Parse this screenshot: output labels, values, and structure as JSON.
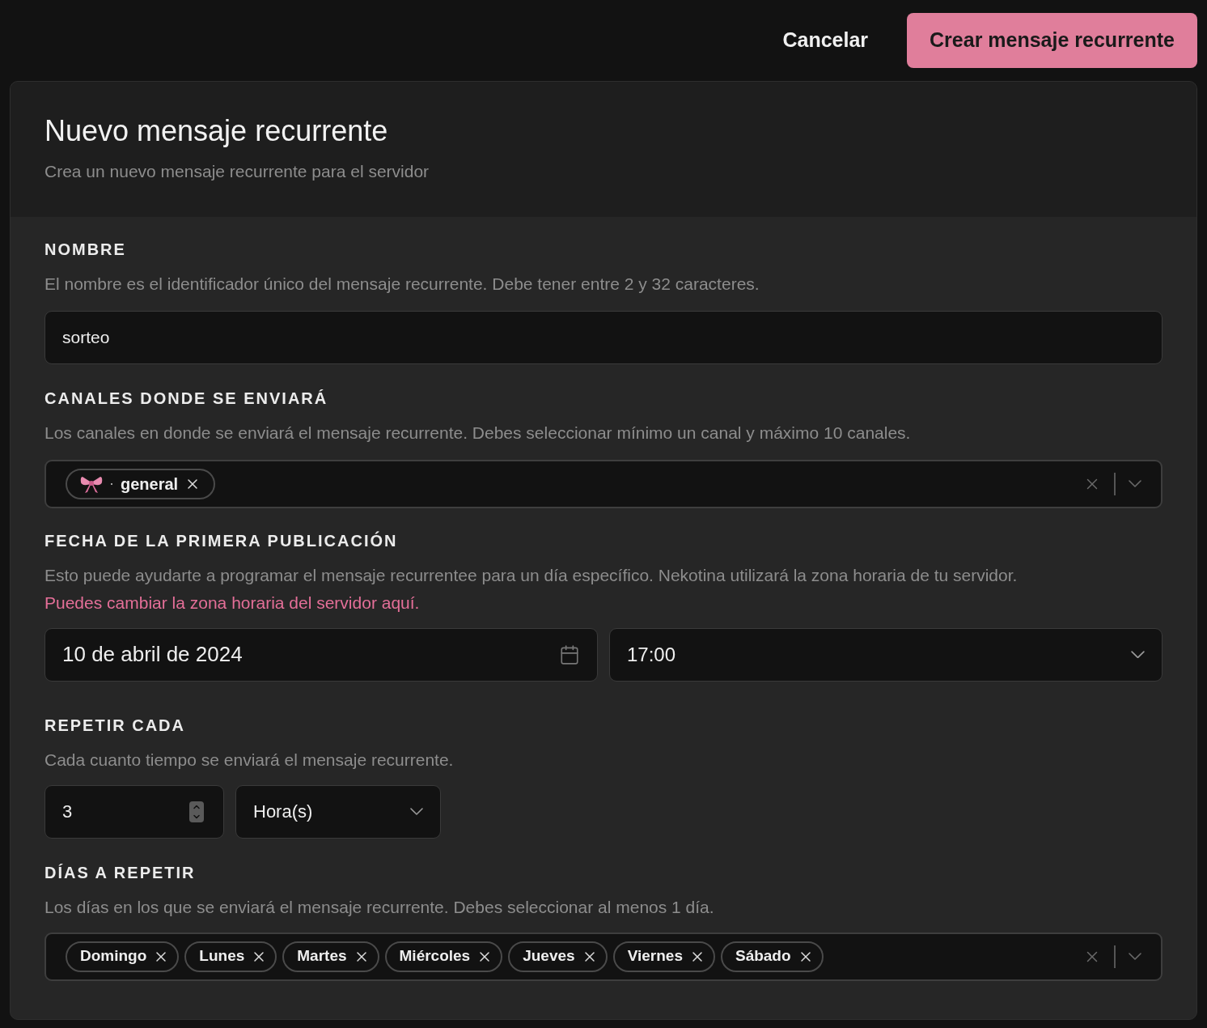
{
  "actions": {
    "cancel": "Cancelar",
    "submit": "Crear mensaje recurrente"
  },
  "header": {
    "title": "Nuevo mensaje recurrente",
    "subtitle": "Crea un nuevo mensaje recurrente para el servidor"
  },
  "name_field": {
    "label": "NOMBRE",
    "help": "El nombre es el identificador único del mensaje recurrente. Debe tener entre 2 y 32 caracteres.",
    "value": "sorteo"
  },
  "channels_field": {
    "label": "CANALES DONDE SE ENVIARÁ",
    "help": "Los canales en donde se enviará el mensaje recurrente. Debes seleccionar mínimo un canal y máximo 10 canales.",
    "tags": [
      {
        "separator": "·",
        "name": "general"
      }
    ]
  },
  "date_field": {
    "label": "FECHA DE LA PRIMERA PUBLICACIÓN",
    "help": "Esto puede ayudarte a programar el mensaje recurrentee para un día específico. Nekotina utilizará la zona horaria de tu servidor.",
    "link": "Puedes cambiar la zona horaria del servidor aquí.",
    "date": "10 de abril de 2024",
    "time": "17:00"
  },
  "repeat_field": {
    "label": "REPETIR CADA",
    "help": "Cada cuanto tiempo se enviará el mensaje recurrente.",
    "amount": "3",
    "unit": "Hora(s)"
  },
  "days_field": {
    "label": "DÍAS A REPETIR",
    "help": "Los días en los que se enviará el mensaje recurrente. Debes seleccionar al menos 1 día.",
    "tags": [
      "Domingo",
      "Lunes",
      "Martes",
      "Miércoles",
      "Jueves",
      "Viernes",
      "Sábado"
    ]
  }
}
